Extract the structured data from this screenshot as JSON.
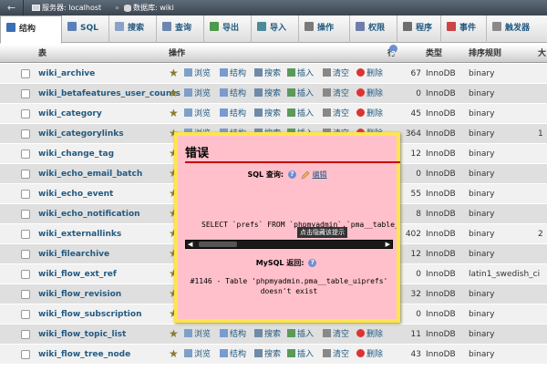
{
  "breadcrumb": {
    "back_glyph": "←",
    "server_label": "服务器: localhost",
    "separator": "»",
    "database_label": "数据库: wiki"
  },
  "tabs": [
    {
      "label": "结构",
      "icon": "structure-icon",
      "color": "#3a6eb5"
    },
    {
      "label": "SQL",
      "icon": "sql-icon",
      "color": "#5b7fb8"
    },
    {
      "label": "搜索",
      "icon": "search-icon",
      "color": "#8aa2c8"
    },
    {
      "label": "查询",
      "icon": "query-icon",
      "color": "#6c86ad"
    },
    {
      "label": "导出",
      "icon": "export-icon",
      "color": "#4c9a4c"
    },
    {
      "label": "导入",
      "icon": "import-icon",
      "color": "#4c8a9a"
    },
    {
      "label": "操作",
      "icon": "wrench-icon",
      "color": "#7a7a7a"
    },
    {
      "label": "权限",
      "icon": "privileges-icon",
      "color": "#6d7fa8"
    },
    {
      "label": "程序",
      "icon": "routines-icon",
      "color": "#6d6d6d"
    },
    {
      "label": "事件",
      "icon": "events-icon",
      "color": "#c44"
    },
    {
      "label": "触发器",
      "icon": "triggers-icon",
      "color": "#8a8a8a"
    }
  ],
  "columns": {
    "table": "表",
    "sort_arrow": "▲",
    "action": "操作",
    "rows": "行数",
    "type": "类型",
    "collation": "排序规则",
    "size": "大"
  },
  "actions": {
    "browse": "浏览",
    "structure": "结构",
    "search": "搜索",
    "insert": "插入",
    "empty": "清空",
    "drop": "删除"
  },
  "tables": [
    {
      "name": "wiki_archive",
      "rows": "67",
      "engine": "InnoDB",
      "collation": "binary",
      "extra": ""
    },
    {
      "name": "wiki_betafeatures_user_counts",
      "rows": "0",
      "engine": "InnoDB",
      "collation": "binary",
      "extra": ""
    },
    {
      "name": "wiki_category",
      "rows": "45",
      "engine": "InnoDB",
      "collation": "binary",
      "extra": ""
    },
    {
      "name": "wiki_categorylinks",
      "rows": "364",
      "engine": "InnoDB",
      "collation": "binary",
      "extra": "1"
    },
    {
      "name": "wiki_change_tag",
      "rows": "12",
      "engine": "InnoDB",
      "collation": "binary",
      "extra": ""
    },
    {
      "name": "wiki_echo_email_batch",
      "rows": "0",
      "engine": "InnoDB",
      "collation": "binary",
      "extra": ""
    },
    {
      "name": "wiki_echo_event",
      "rows": "55",
      "engine": "InnoDB",
      "collation": "binary",
      "extra": ""
    },
    {
      "name": "wiki_echo_notification",
      "rows": "8",
      "engine": "InnoDB",
      "collation": "binary",
      "extra": ""
    },
    {
      "name": "wiki_externallinks",
      "rows": "402",
      "engine": "InnoDB",
      "collation": "binary",
      "extra": "2"
    },
    {
      "name": "wiki_filearchive",
      "rows": "12",
      "engine": "InnoDB",
      "collation": "binary",
      "extra": ""
    },
    {
      "name": "wiki_flow_ext_ref",
      "rows": "0",
      "engine": "InnoDB",
      "collation": "latin1_swedish_ci",
      "extra": ""
    },
    {
      "name": "wiki_flow_revision",
      "rows": "32",
      "engine": "InnoDB",
      "collation": "binary",
      "extra": ""
    },
    {
      "name": "wiki_flow_subscription",
      "rows": "0",
      "engine": "InnoDB",
      "collation": "binary",
      "extra": ""
    },
    {
      "name": "wiki_flow_topic_list",
      "rows": "11",
      "engine": "InnoDB",
      "collation": "binary",
      "extra": ""
    },
    {
      "name": "wiki_flow_tree_node",
      "rows": "43",
      "engine": "InnoDB",
      "collation": "binary",
      "extra": ""
    }
  ],
  "error_dialog": {
    "title": "错误",
    "sql_query_label": "SQL 查询:",
    "edit_link": "编辑",
    "help_glyph": "?",
    "query": "SELECT `prefs` FROM `phpmyadmin`.`pma__table_uiprefs` WHERE `username` = 'root'",
    "tooltip": "点击隐藏该提示",
    "mysql_said_label": "MySQL 返回:",
    "message": "#1146 - Table 'phpmyadmin.pma__table_uiprefs' doesn't exist"
  },
  "colors": {
    "link": "#235a81",
    "dialog_bg": "#ffc0cb",
    "dialog_border": "#ffe54a",
    "title_rule": "#cc0000"
  }
}
